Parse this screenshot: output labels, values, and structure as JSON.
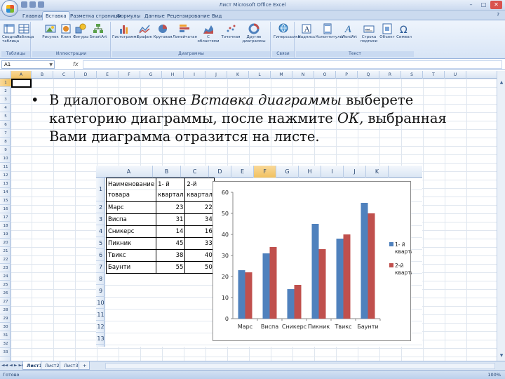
{
  "window": {
    "title": "Лист Microsoft Office Excel",
    "controls": [
      "–",
      "□",
      "✕"
    ]
  },
  "ribbon": {
    "tabs": [
      "Главная",
      "Вставка",
      "Разметка страницы",
      "Формулы",
      "Данные",
      "Рецензирование",
      "Вид"
    ],
    "active_tab": "Вставка",
    "groups": [
      {
        "label": "Таблицы",
        "buttons": [
          "Сводная таблица",
          "Таблица"
        ]
      },
      {
        "label": "Иллюстрации",
        "buttons": [
          "Рисунок",
          "Клип",
          "Фигуры",
          "SmartArt"
        ]
      },
      {
        "label": "Диаграммы",
        "buttons": [
          "Гистограмма",
          "График",
          "Круговая",
          "Линейчатая",
          "С областями",
          "Точечная",
          "Другие диаграммы"
        ]
      },
      {
        "label": "Связи",
        "buttons": [
          "Гиперссылка"
        ]
      },
      {
        "label": "Текст",
        "buttons": [
          "Надпись",
          "Колонтитулы",
          "WordArt",
          "Строка подписи",
          "Объект",
          "Символ"
        ]
      }
    ]
  },
  "formula_bar": {
    "name_box": "A1",
    "fx": "fx",
    "value": ""
  },
  "grid": {
    "columns": [
      "A",
      "B",
      "C",
      "D",
      "E",
      "F",
      "G",
      "H",
      "I",
      "J",
      "K",
      "L",
      "M",
      "N",
      "O",
      "P",
      "Q",
      "R",
      "S",
      "T",
      "U"
    ],
    "rows": [
      "1",
      "2",
      "3",
      "4",
      "5",
      "6",
      "7",
      "8",
      "9",
      "10",
      "11",
      "12",
      "13",
      "14",
      "15",
      "16",
      "17",
      "18",
      "19",
      "20",
      "21",
      "22",
      "23",
      "24",
      "25",
      "26",
      "27",
      "28",
      "29",
      "30",
      "31",
      "32",
      "33"
    ],
    "selected_column": "A",
    "selected_row": "1"
  },
  "slide_text": {
    "bullet": "•",
    "part1": "В диалоговом окне ",
    "italic1": "Вставка диаграммы",
    "part2": " выберете категорию диаграммы, после нажмите ",
    "italic2": "ОК,",
    "part3": " выбранная Вами диаграмма отразится на листе."
  },
  "embedded_sheet": {
    "columns": [
      "A",
      "B",
      "C",
      "D",
      "E",
      "F",
      "G",
      "H",
      "I",
      "J",
      "K"
    ],
    "selected_column": "F",
    "rows": [
      "1",
      "2",
      "3",
      "4",
      "5",
      "6",
      "7",
      "8",
      "9",
      "10",
      "11",
      "12",
      "13",
      "14"
    ],
    "table_header": [
      "Наименование товара",
      "1- й квартал",
      "2-й квартал"
    ],
    "table_rows": [
      [
        "Марс",
        "23",
        "22"
      ],
      [
        "Виспа",
        "31",
        "34"
      ],
      [
        "Сникерс",
        "14",
        "16"
      ],
      [
        "Пикник",
        "45",
        "33"
      ],
      [
        "Твикс",
        "38",
        "40"
      ],
      [
        "Баунти",
        "55",
        "50"
      ]
    ]
  },
  "chart_data": {
    "type": "bar",
    "categories": [
      "Марс",
      "Виспа",
      "Сникерс",
      "Пикник",
      "Твикс",
      "Баунти"
    ],
    "series": [
      {
        "name": "1- й квартал",
        "values": [
          23,
          31,
          14,
          45,
          38,
          55
        ],
        "color": "#4f81bd"
      },
      {
        "name": "2-й квартал",
        "values": [
          22,
          34,
          16,
          33,
          40,
          50
        ],
        "color": "#c0504d"
      }
    ],
    "title": "",
    "xlabel": "",
    "ylabel": "",
    "ylim": [
      0,
      60
    ],
    "yticks": [
      "0",
      "10",
      "20",
      "30",
      "40",
      "50",
      "60"
    ],
    "grid": false,
    "legend_position": "right"
  },
  "sheet_tabs": {
    "tabs": [
      "Лист1",
      "Лист2",
      "Лист3"
    ],
    "active": "Лист1"
  },
  "status": {
    "text": "Готово",
    "zoom": "100%"
  }
}
